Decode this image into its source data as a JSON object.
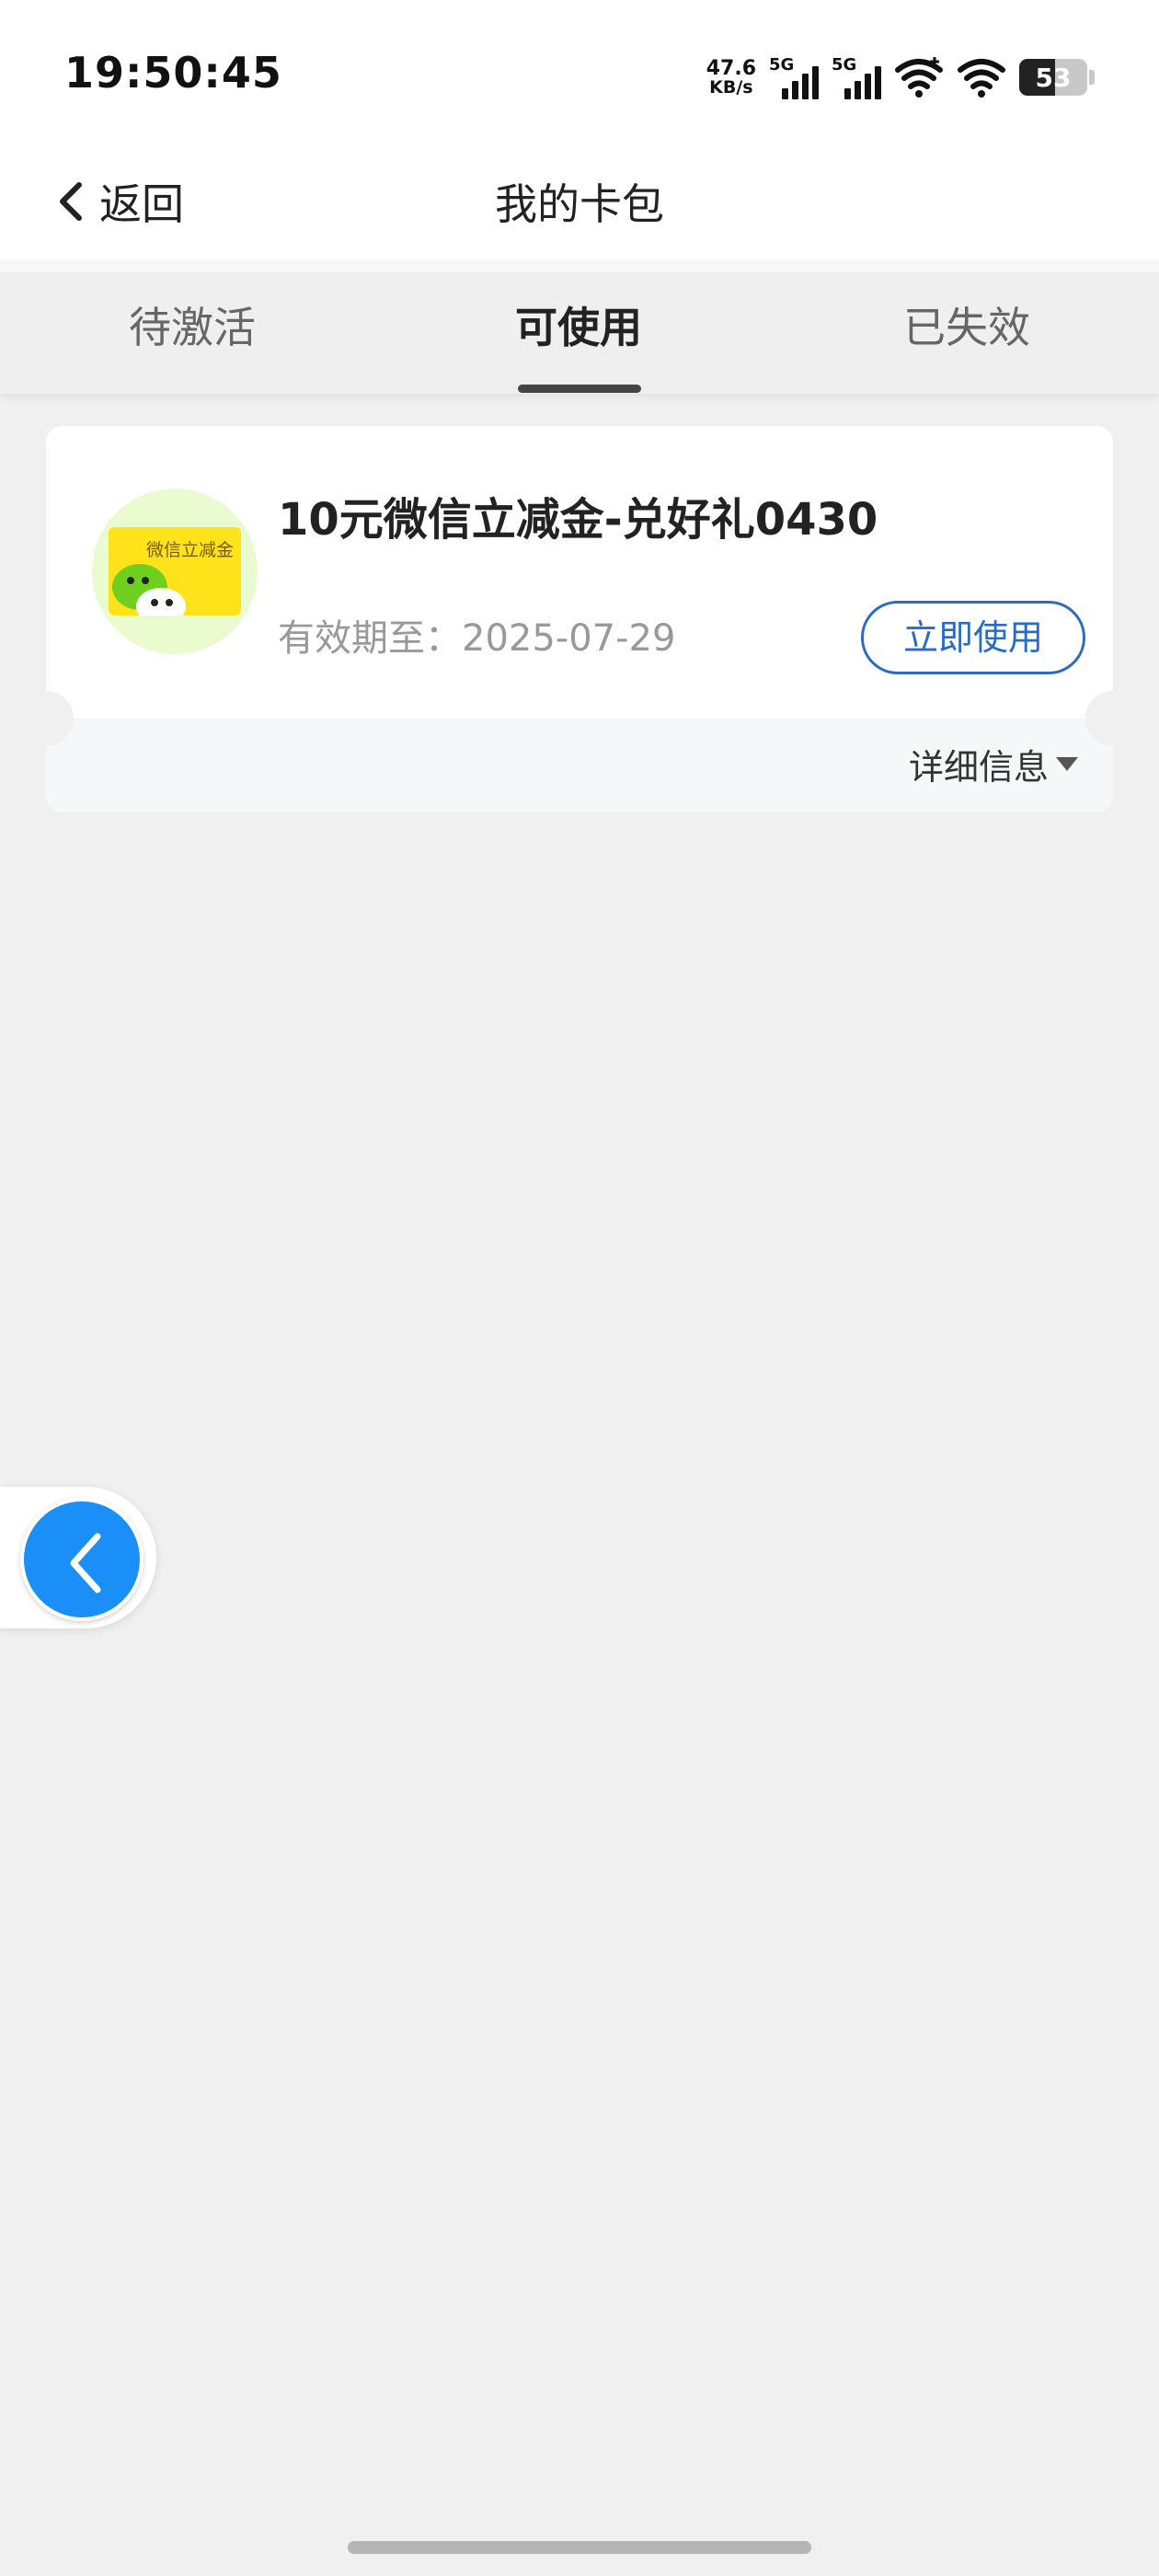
{
  "status_bar": {
    "time": "19:50:45",
    "net_speed_value": "47.6",
    "net_speed_unit": "KB/s",
    "sim1_label": "5G",
    "sim2_label": "5G",
    "battery": "53",
    "icons": [
      "signal-icon",
      "signal-icon",
      "wifi-plus-icon",
      "wifi-icon",
      "battery-icon"
    ]
  },
  "nav": {
    "back_label": "返回",
    "title": "我的卡包"
  },
  "tabs": [
    {
      "label": "待激活",
      "active": false
    },
    {
      "label": "可使用",
      "active": true
    },
    {
      "label": "已失效",
      "active": false
    }
  ],
  "card": {
    "thumb_label": "微信立减金",
    "title": "10元微信立减金-兑好礼0430",
    "expire": "有效期至：2025-07-29",
    "use_label": "立即使用",
    "detail_label": "详细信息",
    "accent_color": "#2a6cc4"
  },
  "colors": {
    "background": "#f0f0f0",
    "float_button": "#1a8ff7"
  }
}
